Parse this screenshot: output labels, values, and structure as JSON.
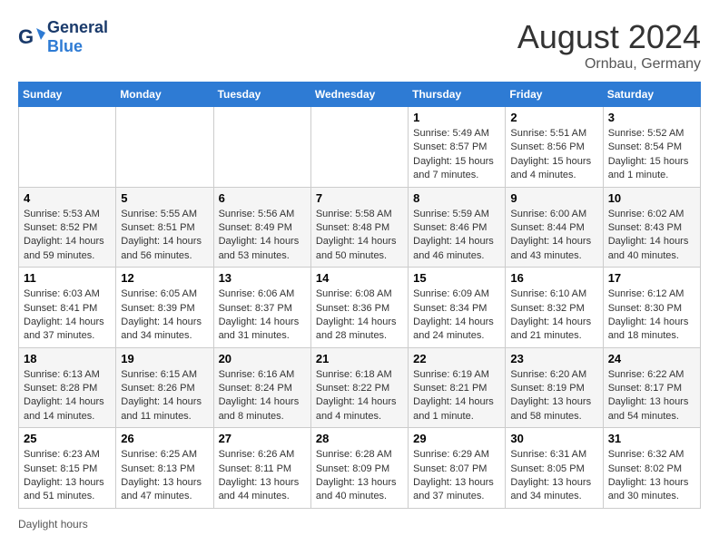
{
  "header": {
    "logo_general": "General",
    "logo_blue": "Blue",
    "month_title": "August 2024",
    "location": "Ornbau, Germany"
  },
  "footer": {
    "daylight_label": "Daylight hours"
  },
  "weekdays": [
    "Sunday",
    "Monday",
    "Tuesday",
    "Wednesday",
    "Thursday",
    "Friday",
    "Saturday"
  ],
  "weeks": [
    [
      {
        "day": "",
        "info": ""
      },
      {
        "day": "",
        "info": ""
      },
      {
        "day": "",
        "info": ""
      },
      {
        "day": "",
        "info": ""
      },
      {
        "day": "1",
        "info": "Sunrise: 5:49 AM\nSunset: 8:57 PM\nDaylight: 15 hours and 7 minutes."
      },
      {
        "day": "2",
        "info": "Sunrise: 5:51 AM\nSunset: 8:56 PM\nDaylight: 15 hours and 4 minutes."
      },
      {
        "day": "3",
        "info": "Sunrise: 5:52 AM\nSunset: 8:54 PM\nDaylight: 15 hours and 1 minute."
      }
    ],
    [
      {
        "day": "4",
        "info": "Sunrise: 5:53 AM\nSunset: 8:52 PM\nDaylight: 14 hours and 59 minutes."
      },
      {
        "day": "5",
        "info": "Sunrise: 5:55 AM\nSunset: 8:51 PM\nDaylight: 14 hours and 56 minutes."
      },
      {
        "day": "6",
        "info": "Sunrise: 5:56 AM\nSunset: 8:49 PM\nDaylight: 14 hours and 53 minutes."
      },
      {
        "day": "7",
        "info": "Sunrise: 5:58 AM\nSunset: 8:48 PM\nDaylight: 14 hours and 50 minutes."
      },
      {
        "day": "8",
        "info": "Sunrise: 5:59 AM\nSunset: 8:46 PM\nDaylight: 14 hours and 46 minutes."
      },
      {
        "day": "9",
        "info": "Sunrise: 6:00 AM\nSunset: 8:44 PM\nDaylight: 14 hours and 43 minutes."
      },
      {
        "day": "10",
        "info": "Sunrise: 6:02 AM\nSunset: 8:43 PM\nDaylight: 14 hours and 40 minutes."
      }
    ],
    [
      {
        "day": "11",
        "info": "Sunrise: 6:03 AM\nSunset: 8:41 PM\nDaylight: 14 hours and 37 minutes."
      },
      {
        "day": "12",
        "info": "Sunrise: 6:05 AM\nSunset: 8:39 PM\nDaylight: 14 hours and 34 minutes."
      },
      {
        "day": "13",
        "info": "Sunrise: 6:06 AM\nSunset: 8:37 PM\nDaylight: 14 hours and 31 minutes."
      },
      {
        "day": "14",
        "info": "Sunrise: 6:08 AM\nSunset: 8:36 PM\nDaylight: 14 hours and 28 minutes."
      },
      {
        "day": "15",
        "info": "Sunrise: 6:09 AM\nSunset: 8:34 PM\nDaylight: 14 hours and 24 minutes."
      },
      {
        "day": "16",
        "info": "Sunrise: 6:10 AM\nSunset: 8:32 PM\nDaylight: 14 hours and 21 minutes."
      },
      {
        "day": "17",
        "info": "Sunrise: 6:12 AM\nSunset: 8:30 PM\nDaylight: 14 hours and 18 minutes."
      }
    ],
    [
      {
        "day": "18",
        "info": "Sunrise: 6:13 AM\nSunset: 8:28 PM\nDaylight: 14 hours and 14 minutes."
      },
      {
        "day": "19",
        "info": "Sunrise: 6:15 AM\nSunset: 8:26 PM\nDaylight: 14 hours and 11 minutes."
      },
      {
        "day": "20",
        "info": "Sunrise: 6:16 AM\nSunset: 8:24 PM\nDaylight: 14 hours and 8 minutes."
      },
      {
        "day": "21",
        "info": "Sunrise: 6:18 AM\nSunset: 8:22 PM\nDaylight: 14 hours and 4 minutes."
      },
      {
        "day": "22",
        "info": "Sunrise: 6:19 AM\nSunset: 8:21 PM\nDaylight: 14 hours and 1 minute."
      },
      {
        "day": "23",
        "info": "Sunrise: 6:20 AM\nSunset: 8:19 PM\nDaylight: 13 hours and 58 minutes."
      },
      {
        "day": "24",
        "info": "Sunrise: 6:22 AM\nSunset: 8:17 PM\nDaylight: 13 hours and 54 minutes."
      }
    ],
    [
      {
        "day": "25",
        "info": "Sunrise: 6:23 AM\nSunset: 8:15 PM\nDaylight: 13 hours and 51 minutes."
      },
      {
        "day": "26",
        "info": "Sunrise: 6:25 AM\nSunset: 8:13 PM\nDaylight: 13 hours and 47 minutes."
      },
      {
        "day": "27",
        "info": "Sunrise: 6:26 AM\nSunset: 8:11 PM\nDaylight: 13 hours and 44 minutes."
      },
      {
        "day": "28",
        "info": "Sunrise: 6:28 AM\nSunset: 8:09 PM\nDaylight: 13 hours and 40 minutes."
      },
      {
        "day": "29",
        "info": "Sunrise: 6:29 AM\nSunset: 8:07 PM\nDaylight: 13 hours and 37 minutes."
      },
      {
        "day": "30",
        "info": "Sunrise: 6:31 AM\nSunset: 8:05 PM\nDaylight: 13 hours and 34 minutes."
      },
      {
        "day": "31",
        "info": "Sunrise: 6:32 AM\nSunset: 8:02 PM\nDaylight: 13 hours and 30 minutes."
      }
    ]
  ]
}
